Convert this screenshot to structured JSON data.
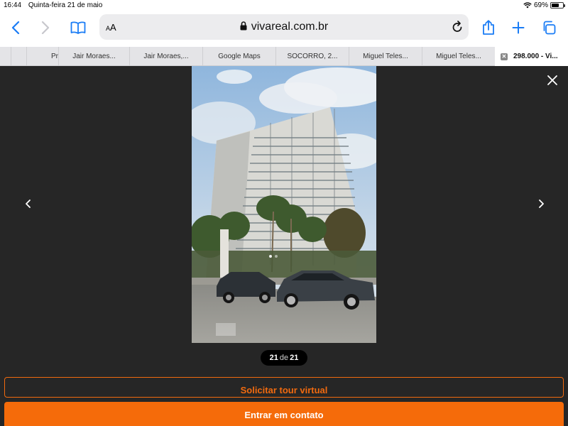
{
  "status_bar": {
    "time": "16:44",
    "date": "Quinta-feira 21 de maio",
    "battery_percent": "69%",
    "battery_level": 0.69
  },
  "toolbar": {
    "text_size_label": "AA",
    "url": "vivareal.com.br"
  },
  "tabs": [
    {
      "label": "Pr"
    },
    {
      "label": "Jair Moraes..."
    },
    {
      "label": "Jair Moraes,..."
    },
    {
      "label": "Google Maps"
    },
    {
      "label": "SOCORRO, 2..."
    },
    {
      "label": "Miguel Teles..."
    },
    {
      "label": "Miguel Teles..."
    },
    {
      "label": "298.000 - Vi...",
      "active": true
    }
  ],
  "viewer": {
    "photo_alt": "Fachada do prédio residencial",
    "counter_current": "21",
    "counter_sep": "de",
    "counter_total": "21"
  },
  "actions": {
    "tour_label": "Solicitar tour virtual",
    "contact_label": "Entrar em contato"
  },
  "colors": {
    "accent": "#f56b0a",
    "viewer_bg": "#262626",
    "ios_blue": "#1a7cf5"
  }
}
